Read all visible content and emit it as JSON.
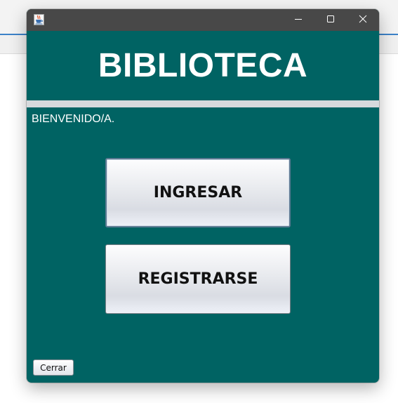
{
  "window": {
    "header_title": "BIBLIOTECA",
    "welcome_text": "BIENVENIDO/A.",
    "buttons": {
      "ingresar": "INGRESAR",
      "registrarse": "REGISTRARSE",
      "cerrar": "Cerrar"
    },
    "titlebar_controls": [
      "minimize-icon",
      "maximize-icon",
      "close-icon"
    ],
    "app_icon": "java-cup-icon"
  },
  "colors": {
    "panel_background": "#006363",
    "titlebar": "#484848",
    "separator": "#d6d9dc",
    "text_light": "#ffffff"
  }
}
